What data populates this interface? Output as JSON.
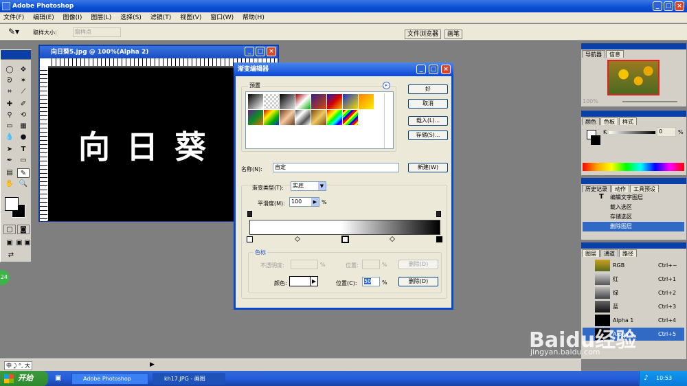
{
  "app": {
    "title": "Adobe Photoshop",
    "window_controls": {
      "minimize": "_",
      "restore": "□",
      "close": "×"
    }
  },
  "menu": [
    "文件(F)",
    "编辑(E)",
    "图像(I)",
    "图层(L)",
    "选择(S)",
    "滤镜(T)",
    "视图(V)",
    "窗口(W)",
    "帮助(H)"
  ],
  "options_bar": {
    "sample_size_label": "取样大小:",
    "sample_size_value": "取样点",
    "tabs": [
      "文件浏览器",
      "画笔"
    ]
  },
  "document": {
    "title": "向日葵5.jpg @ 100%(Alpha 2)",
    "canvas_text": "向 日 葵"
  },
  "gradient_editor": {
    "title": "渐变编辑器",
    "presets_label": "预置",
    "buttons": {
      "ok": "好",
      "cancel": "取消",
      "load": "载入(L)...",
      "save": "存储(S)...",
      "new": "新建(W)"
    },
    "name_label": "名称(N):",
    "name_value": "自定",
    "gradient_type_label": "渐变类型(T):",
    "gradient_type_value": "实底",
    "smoothness_label": "平滑度(M):",
    "smoothness_value": "100",
    "smoothness_unit": "%",
    "stops_group_label": "色标",
    "opacity_label": "不透明度:",
    "opacity_unit": "%",
    "position_label_disabled": "位置:",
    "position_unit_disabled": "%",
    "delete_label_disabled": "删除(D)",
    "color_label": "颜色:",
    "position_label": "位置(C):",
    "position_value": "50",
    "position_unit": "%",
    "delete_label": "删除(D)"
  },
  "navigator_panel": {
    "tabs": [
      "导航器",
      "信息"
    ],
    "zoom": "100%"
  },
  "color_panel": {
    "tabs": [
      "颜色",
      "色板",
      "样式"
    ],
    "channel_label": "K",
    "value": "0",
    "unit": "%"
  },
  "history_panel": {
    "tabs": [
      "历史记录",
      "动作",
      "工具预设"
    ],
    "items": [
      {
        "label": "编辑文字图层",
        "selected": false
      },
      {
        "label": "载入选区",
        "selected": false
      },
      {
        "label": "存储选区",
        "selected": false
      },
      {
        "label": "删除图层",
        "selected": true
      }
    ]
  },
  "channels_panel": {
    "tabs": [
      "图层",
      "通道",
      "路径"
    ],
    "channels": [
      {
        "name": "RGB",
        "shortcut": "Ctrl+~",
        "selected": false
      },
      {
        "name": "红",
        "shortcut": "Ctrl+1",
        "selected": false
      },
      {
        "name": "绿",
        "shortcut": "Ctrl+2",
        "selected": false
      },
      {
        "name": "蓝",
        "shortcut": "Ctrl+3",
        "selected": false
      },
      {
        "name": "Alpha 1",
        "shortcut": "Ctrl+4",
        "selected": false
      },
      {
        "name": "Alpha 2",
        "shortcut": "Ctrl+5",
        "selected": true
      }
    ]
  },
  "ime_bar": "中 ⤸ °, 大",
  "badge": "24",
  "taskbar": {
    "start": "开始",
    "tasks": [
      "Adobe Photoshop",
      "kh17.JPG - 画图"
    ],
    "clock": "10:53"
  },
  "watermark": {
    "text": "Baidu经验",
    "url": "jingyan.baidu.com"
  }
}
